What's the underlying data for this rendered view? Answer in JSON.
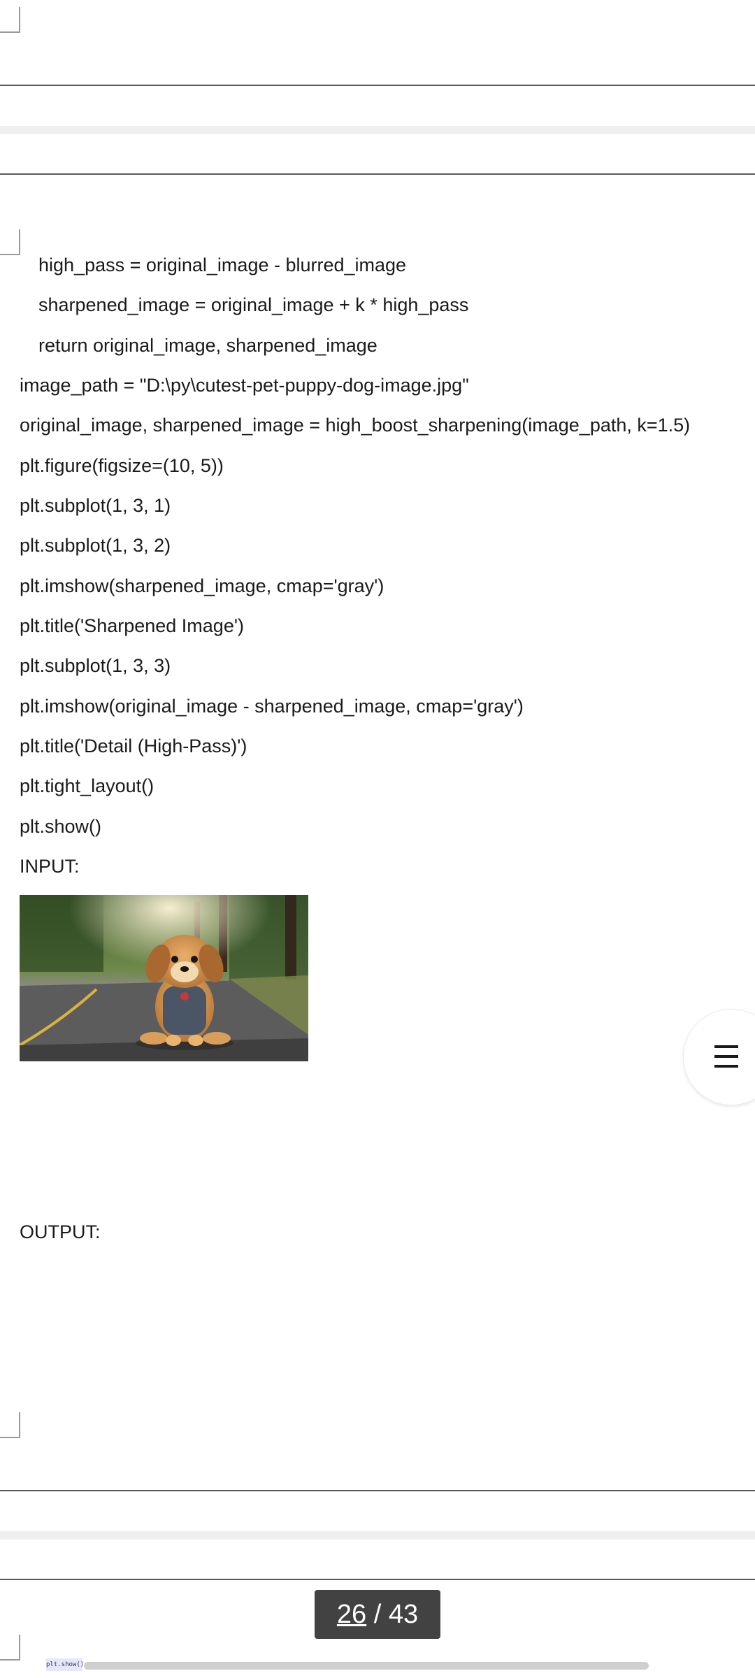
{
  "code": {
    "line1": "high_pass = original_image - blurred_image",
    "line2": "sharpened_image = original_image + k * high_pass",
    "line3": "return original_image, sharpened_image",
    "line4": "image_path = \"D:\\py\\cutest-pet-puppy-dog-image.jpg\"",
    "line5": "original_image, sharpened_image = high_boost_sharpening(image_path, k=1.5)",
    "line6": "plt.figure(figsize=(10, 5))",
    "line7": "plt.subplot(1, 3, 1)",
    "line8": "plt.subplot(1, 3, 2)",
    "line9": "plt.imshow(sharpened_image, cmap='gray')",
    "line10": "plt.title('Sharpened Image')",
    "line11": "plt.subplot(1, 3, 3)",
    "line12": "plt.imshow(original_image - sharpened_image, cmap='gray')",
    "line13": "plt.title('Detail (High-Pass)')",
    "line14": "plt.tight_layout()",
    "line15": "plt.show()"
  },
  "labels": {
    "input": "INPUT:",
    "output": "OUTPUT:"
  },
  "pager": {
    "current": "26",
    "separator": " / ",
    "total": "43"
  },
  "thumbnail": {
    "text": "plt.show()"
  },
  "icons": {
    "menu": "hamburger-menu-icon"
  },
  "colors": {
    "pager_bg": "#424242",
    "divider": "#5a5a5a",
    "page_gap": "#efefef"
  }
}
